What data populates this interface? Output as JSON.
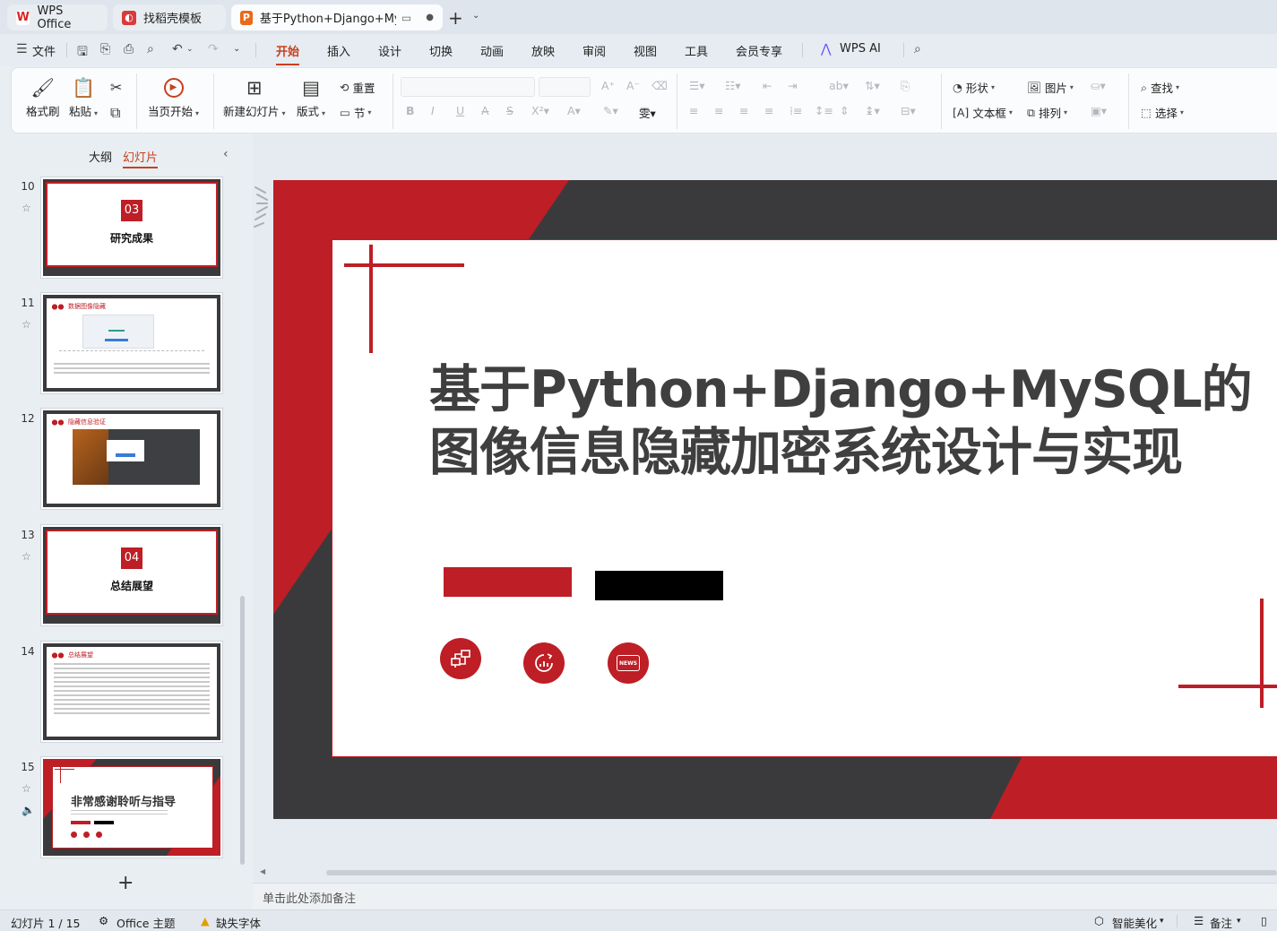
{
  "tabs": [
    {
      "label": "WPS Office",
      "icon": "wps-logo-icon"
    },
    {
      "label": "找稻壳模板",
      "icon": "docer-icon"
    },
    {
      "label": "基于Python+Django+MySQ",
      "icon": "presentation-icon"
    }
  ],
  "menu": {
    "file": "文件",
    "items": [
      "开始",
      "插入",
      "设计",
      "切换",
      "动画",
      "放映",
      "审阅",
      "视图",
      "工具",
      "会员专享"
    ],
    "wps_ai": "WPS AI"
  },
  "ribbon": {
    "format_painter": "格式刷",
    "paste": "粘贴",
    "start_from_current": "当页开始",
    "new_slide": "新建幻灯片",
    "layout": "版式",
    "reset": "重置",
    "section": "节",
    "shape": "形状",
    "picture": "图片",
    "textbox": "文本框",
    "arrange": "排列",
    "find": "查找",
    "select": "选择"
  },
  "panel": {
    "outline_tab": "大纲",
    "slides_tab": "幻灯片"
  },
  "thumbnails": [
    {
      "num": "10",
      "section_num": "03",
      "title": "研究成果"
    },
    {
      "num": "11",
      "header": "数据图像隐藏"
    },
    {
      "num": "12",
      "header": "隐藏信息验证"
    },
    {
      "num": "13",
      "section_num": "04",
      "title": "总结展望"
    },
    {
      "num": "14",
      "header": "总结展望"
    },
    {
      "num": "15",
      "title": "非常感谢聆听与指导"
    }
  ],
  "slide": {
    "title_line1": "基于Python+Django+MySQL的",
    "title_line2": "图像信息隐藏加密系统设计与实现",
    "icons": [
      "network-icon",
      "chart-icon",
      "news-icon"
    ],
    "news_text": "NEWS"
  },
  "notes_placeholder": "单击此处添加备注",
  "status": {
    "slide_counter": "幻灯片 1 / 15",
    "theme": "Office 主题",
    "missing_font": "缺失字体",
    "smart_beautify": "智能美化",
    "notes": "备注"
  },
  "colors": {
    "accent": "#c8401e",
    "slide_red": "#be1e25",
    "slide_dark": "#3a3a3c"
  }
}
